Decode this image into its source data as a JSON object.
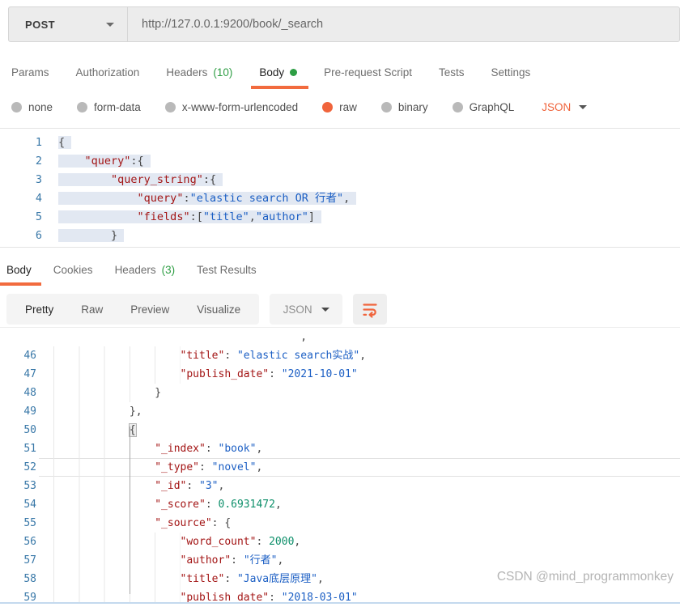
{
  "ui_colors": {
    "accent_orange": "#f26b3e",
    "selected_radio_orange": "#f0643c",
    "count_green": "#2e9e44",
    "key_red": "#a31515",
    "string_blue": "#1c5fc4",
    "number_green": "#0d8f6a",
    "line_number_blue": "#3978a8",
    "selection_bg": "#e2e8f2",
    "bar_bg": "#ececec"
  },
  "request": {
    "method": "POST",
    "url": "http://127.0.0.1:9200/book/_search",
    "tabs": [
      {
        "label": "Params",
        "count": ""
      },
      {
        "label": "Authorization",
        "count": ""
      },
      {
        "label": "Headers",
        "count": "(10)"
      },
      {
        "label": "Body",
        "count": ""
      },
      {
        "label": "Pre-request Script",
        "count": ""
      },
      {
        "label": "Tests",
        "count": ""
      },
      {
        "label": "Settings",
        "count": ""
      }
    ],
    "body_types": [
      {
        "label": "none"
      },
      {
        "label": "form-data"
      },
      {
        "label": "x-www-form-urlencoded"
      },
      {
        "label": "raw"
      },
      {
        "label": "binary"
      },
      {
        "label": "GraphQL"
      }
    ],
    "body_language": "JSON"
  },
  "request_editor": {
    "lines": [
      {
        "n": "1",
        "ind": 0,
        "sel": true,
        "tokens": [
          [
            "p",
            "{"
          ]
        ]
      },
      {
        "n": "2",
        "ind": 4,
        "sel": true,
        "tokens": [
          [
            "k",
            "\"query\""
          ],
          [
            "p",
            ":{"
          ]
        ]
      },
      {
        "n": "3",
        "ind": 8,
        "sel": true,
        "tokens": [
          [
            "k",
            "\"query_string\""
          ],
          [
            "p",
            ":{"
          ]
        ]
      },
      {
        "n": "4",
        "ind": 12,
        "sel": true,
        "tokens": [
          [
            "k",
            "\"query\""
          ],
          [
            "p",
            ":"
          ],
          [
            "s",
            "\"elastic search OR 行者\""
          ],
          [
            "p",
            ","
          ]
        ]
      },
      {
        "n": "5",
        "ind": 12,
        "sel": true,
        "tokens": [
          [
            "k",
            "\"fields\""
          ],
          [
            "p",
            ":["
          ],
          [
            "s",
            "\"title\""
          ],
          [
            "p",
            ","
          ],
          [
            "s",
            "\"author\""
          ],
          [
            "p",
            "]"
          ]
        ]
      },
      {
        "n": "6",
        "ind": 8,
        "sel": true,
        "tokens": [
          [
            "p",
            "}"
          ]
        ]
      }
    ]
  },
  "response": {
    "tabs": [
      {
        "label": "Body",
        "count": ""
      },
      {
        "label": "Cookies",
        "count": ""
      },
      {
        "label": "Headers",
        "count": "(3)"
      },
      {
        "label": "Test Results",
        "count": ""
      }
    ],
    "views": [
      {
        "label": "Pretty"
      },
      {
        "label": "Raw"
      },
      {
        "label": "Preview"
      },
      {
        "label": "Visualize"
      }
    ],
    "language": "JSON"
  },
  "response_editor": {
    "lines": [
      {
        "n": "",
        "ind": 39,
        "spaces": true,
        "tokens": [
          [
            "p",
            ","
          ]
        ]
      },
      {
        "n": "46",
        "ind": 20,
        "tokens": [
          [
            "k",
            "\"title\""
          ],
          [
            "p",
            ": "
          ],
          [
            "s",
            "\"elastic search实战\""
          ],
          [
            "p",
            ","
          ]
        ]
      },
      {
        "n": "47",
        "ind": 20,
        "tokens": [
          [
            "k",
            "\"publish_date\""
          ],
          [
            "p",
            ": "
          ],
          [
            "s",
            "\"2021-10-01\""
          ]
        ]
      },
      {
        "n": "48",
        "ind": 16,
        "tokens": [
          [
            "p",
            "}"
          ]
        ]
      },
      {
        "n": "49",
        "ind": 12,
        "tokens": [
          [
            "p",
            "},"
          ]
        ]
      },
      {
        "n": "50",
        "ind": 12,
        "tokens": [
          [
            "b",
            "{"
          ]
        ]
      },
      {
        "n": "51",
        "ind": 16,
        "tokens": [
          [
            "k",
            "\"_index\""
          ],
          [
            "p",
            ": "
          ],
          [
            "s",
            "\"book\""
          ],
          [
            "p",
            ","
          ]
        ]
      },
      {
        "n": "52",
        "ind": 16,
        "cur": true,
        "tokens": [
          [
            "k",
            "\"_type\""
          ],
          [
            "p",
            ": "
          ],
          [
            "s",
            "\"novel\""
          ],
          [
            "p",
            ","
          ]
        ]
      },
      {
        "n": "53",
        "ind": 16,
        "tokens": [
          [
            "k",
            "\"_id\""
          ],
          [
            "p",
            ": "
          ],
          [
            "s",
            "\"3\""
          ],
          [
            "p",
            ","
          ]
        ]
      },
      {
        "n": "54",
        "ind": 16,
        "tokens": [
          [
            "k",
            "\"_score\""
          ],
          [
            "p",
            ": "
          ],
          [
            "n",
            "0.6931472"
          ],
          [
            "p",
            ","
          ]
        ]
      },
      {
        "n": "55",
        "ind": 16,
        "tokens": [
          [
            "k",
            "\"_source\""
          ],
          [
            "p",
            ": {"
          ]
        ]
      },
      {
        "n": "56",
        "ind": 20,
        "tokens": [
          [
            "k",
            "\"word_count\""
          ],
          [
            "p",
            ": "
          ],
          [
            "n",
            "2000"
          ],
          [
            "p",
            ","
          ]
        ]
      },
      {
        "n": "57",
        "ind": 20,
        "tokens": [
          [
            "k",
            "\"author\""
          ],
          [
            "p",
            ": "
          ],
          [
            "s",
            "\"行者\""
          ],
          [
            "p",
            ","
          ]
        ]
      },
      {
        "n": "58",
        "ind": 20,
        "tokens": [
          [
            "k",
            "\"title\""
          ],
          [
            "p",
            ": "
          ],
          [
            "s",
            "\"Java底层原理\""
          ],
          [
            "p",
            ","
          ]
        ]
      },
      {
        "n": "59",
        "ind": 20,
        "tokens": [
          [
            "k",
            "\"publish_date\""
          ],
          [
            "p",
            ": "
          ],
          [
            "s",
            "\"2018-03-01\""
          ]
        ]
      }
    ]
  },
  "watermark": "CSDN @mind_programmonkey"
}
